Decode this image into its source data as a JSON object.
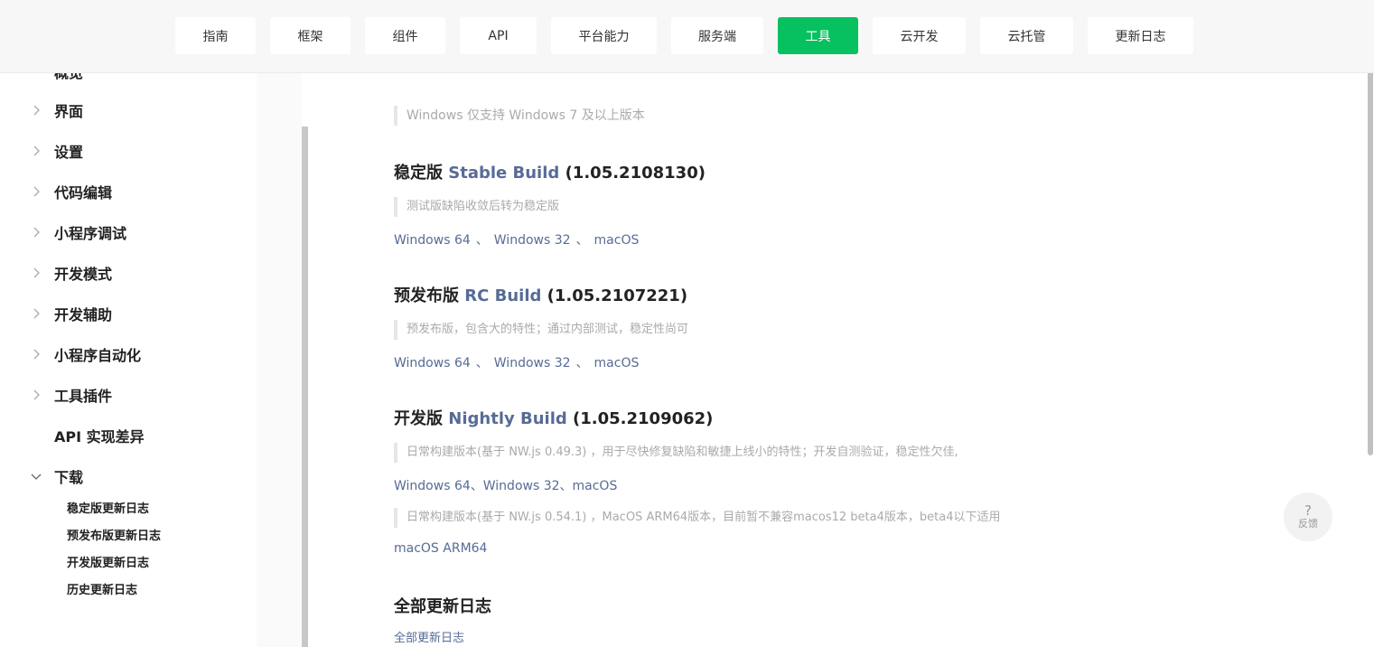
{
  "nav": {
    "tabs": [
      {
        "label": "指南"
      },
      {
        "label": "框架"
      },
      {
        "label": "组件"
      },
      {
        "label": "API"
      },
      {
        "label": "平台能力"
      },
      {
        "label": "服务端"
      },
      {
        "label": "工具",
        "active": true
      },
      {
        "label": "云开发"
      },
      {
        "label": "云托管"
      },
      {
        "label": "更新日志"
      }
    ]
  },
  "sidebar": {
    "partial_top": "概览",
    "items": [
      {
        "label": "界面",
        "icon": "chevron-right-icon"
      },
      {
        "label": "设置",
        "icon": "chevron-right-icon"
      },
      {
        "label": "代码编辑",
        "icon": "chevron-right-icon"
      },
      {
        "label": "小程序调试",
        "icon": "chevron-right-icon"
      },
      {
        "label": "开发模式",
        "icon": "chevron-right-icon"
      },
      {
        "label": "开发辅助",
        "icon": "chevron-right-icon"
      },
      {
        "label": "小程序自动化",
        "icon": "chevron-right-icon"
      },
      {
        "label": "工具插件",
        "icon": "chevron-right-icon"
      },
      {
        "label": "API 实现差异",
        "icon": ""
      },
      {
        "label": "下载",
        "icon": "chevron-down-icon"
      }
    ],
    "subitems": [
      {
        "label": "稳定版更新日志"
      },
      {
        "label": "预发布版更新日志"
      },
      {
        "label": "开发版更新日志"
      },
      {
        "label": "历史更新日志"
      }
    ]
  },
  "content": {
    "windows_note": "Windows 仅支持 Windows 7 及以上版本",
    "stable": {
      "prefix": "稳定版",
      "name": "Stable Build",
      "version": "(1.05.2108130)",
      "note": "测试版缺陷收敛后转为稳定版",
      "links": [
        "Windows 64",
        "Windows 32",
        "macOS"
      ],
      "sep": "、"
    },
    "rc": {
      "prefix": "预发布版",
      "name": "RC Build",
      "version": "(1.05.2107221)",
      "note": "预发布版，包含大的特性；通过内部测试，稳定性尚可",
      "links": [
        "Windows 64",
        "Windows 32",
        "macOS"
      ],
      "sep": "、"
    },
    "nightly": {
      "prefix": "开发版",
      "name": "Nightly Build",
      "version": "(1.05.2109062)",
      "note1": "日常构建版本(基于 NW.js 0.49.3) ，用于尽快修复缺陷和敏捷上线小的特性；开发自测验证，稳定性欠佳,",
      "links_line": "Windows 64、Windows 32、macOS",
      "note2": "日常构建版本(基于 NW.js 0.54.1) ，MacOS ARM64版本，目前暂不兼容macos12 beta4版本，beta4以下适用",
      "arm_link": "macOS ARM64"
    },
    "all": {
      "title": "全部更新日志",
      "link": "全部更新日志"
    }
  },
  "feedback": {
    "icon": "question-icon",
    "symbol": "?",
    "label": "反馈"
  },
  "colors": {
    "accent": "#07c160",
    "link": "#576b95"
  }
}
